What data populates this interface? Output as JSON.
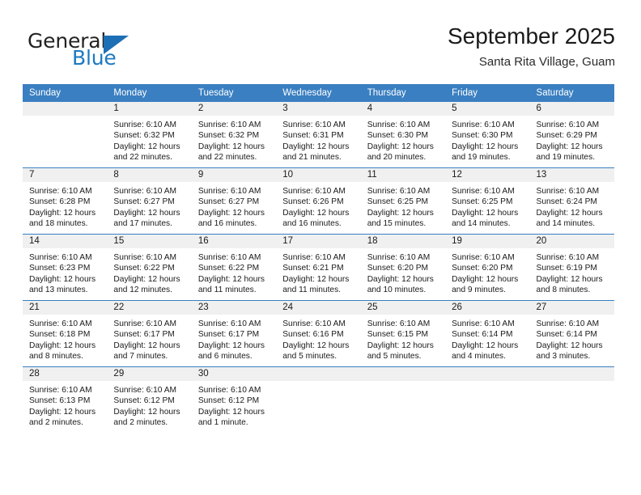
{
  "brand": {
    "name_part1": "General",
    "name_part2": "Blue",
    "triangle_color": "#1c6fb5",
    "blue_text_color": "#1c79c0"
  },
  "header": {
    "title": "September 2025",
    "subtitle": "Santa Rita Village, Guam"
  },
  "theme": {
    "header_row_background": "#3a7fc1",
    "header_row_text": "#ffffff",
    "daynumber_band_background": "#f0f0f0",
    "cell_background": "#ffffff",
    "row_divider": "#3a7fc1"
  },
  "weekday_headers": [
    "Sunday",
    "Monday",
    "Tuesday",
    "Wednesday",
    "Thursday",
    "Friday",
    "Saturday"
  ],
  "weeks": [
    [
      {
        "day": "",
        "blank": true,
        "sunrise": "",
        "sunset": "",
        "daylight_line1": "",
        "daylight_line2": ""
      },
      {
        "day": "1",
        "sunrise": "Sunrise: 6:10 AM",
        "sunset": "Sunset: 6:32 PM",
        "daylight_line1": "Daylight: 12 hours",
        "daylight_line2": "and 22 minutes."
      },
      {
        "day": "2",
        "sunrise": "Sunrise: 6:10 AM",
        "sunset": "Sunset: 6:32 PM",
        "daylight_line1": "Daylight: 12 hours",
        "daylight_line2": "and 22 minutes."
      },
      {
        "day": "3",
        "sunrise": "Sunrise: 6:10 AM",
        "sunset": "Sunset: 6:31 PM",
        "daylight_line1": "Daylight: 12 hours",
        "daylight_line2": "and 21 minutes."
      },
      {
        "day": "4",
        "sunrise": "Sunrise: 6:10 AM",
        "sunset": "Sunset: 6:30 PM",
        "daylight_line1": "Daylight: 12 hours",
        "daylight_line2": "and 20 minutes."
      },
      {
        "day": "5",
        "sunrise": "Sunrise: 6:10 AM",
        "sunset": "Sunset: 6:30 PM",
        "daylight_line1": "Daylight: 12 hours",
        "daylight_line2": "and 19 minutes."
      },
      {
        "day": "6",
        "sunrise": "Sunrise: 6:10 AM",
        "sunset": "Sunset: 6:29 PM",
        "daylight_line1": "Daylight: 12 hours",
        "daylight_line2": "and 19 minutes."
      }
    ],
    [
      {
        "day": "7",
        "sunrise": "Sunrise: 6:10 AM",
        "sunset": "Sunset: 6:28 PM",
        "daylight_line1": "Daylight: 12 hours",
        "daylight_line2": "and 18 minutes."
      },
      {
        "day": "8",
        "sunrise": "Sunrise: 6:10 AM",
        "sunset": "Sunset: 6:27 PM",
        "daylight_line1": "Daylight: 12 hours",
        "daylight_line2": "and 17 minutes."
      },
      {
        "day": "9",
        "sunrise": "Sunrise: 6:10 AM",
        "sunset": "Sunset: 6:27 PM",
        "daylight_line1": "Daylight: 12 hours",
        "daylight_line2": "and 16 minutes."
      },
      {
        "day": "10",
        "sunrise": "Sunrise: 6:10 AM",
        "sunset": "Sunset: 6:26 PM",
        "daylight_line1": "Daylight: 12 hours",
        "daylight_line2": "and 16 minutes."
      },
      {
        "day": "11",
        "sunrise": "Sunrise: 6:10 AM",
        "sunset": "Sunset: 6:25 PM",
        "daylight_line1": "Daylight: 12 hours",
        "daylight_line2": "and 15 minutes."
      },
      {
        "day": "12",
        "sunrise": "Sunrise: 6:10 AM",
        "sunset": "Sunset: 6:25 PM",
        "daylight_line1": "Daylight: 12 hours",
        "daylight_line2": "and 14 minutes."
      },
      {
        "day": "13",
        "sunrise": "Sunrise: 6:10 AM",
        "sunset": "Sunset: 6:24 PM",
        "daylight_line1": "Daylight: 12 hours",
        "daylight_line2": "and 14 minutes."
      }
    ],
    [
      {
        "day": "14",
        "sunrise": "Sunrise: 6:10 AM",
        "sunset": "Sunset: 6:23 PM",
        "daylight_line1": "Daylight: 12 hours",
        "daylight_line2": "and 13 minutes."
      },
      {
        "day": "15",
        "sunrise": "Sunrise: 6:10 AM",
        "sunset": "Sunset: 6:22 PM",
        "daylight_line1": "Daylight: 12 hours",
        "daylight_line2": "and 12 minutes."
      },
      {
        "day": "16",
        "sunrise": "Sunrise: 6:10 AM",
        "sunset": "Sunset: 6:22 PM",
        "daylight_line1": "Daylight: 12 hours",
        "daylight_line2": "and 11 minutes."
      },
      {
        "day": "17",
        "sunrise": "Sunrise: 6:10 AM",
        "sunset": "Sunset: 6:21 PM",
        "daylight_line1": "Daylight: 12 hours",
        "daylight_line2": "and 11 minutes."
      },
      {
        "day": "18",
        "sunrise": "Sunrise: 6:10 AM",
        "sunset": "Sunset: 6:20 PM",
        "daylight_line1": "Daylight: 12 hours",
        "daylight_line2": "and 10 minutes."
      },
      {
        "day": "19",
        "sunrise": "Sunrise: 6:10 AM",
        "sunset": "Sunset: 6:20 PM",
        "daylight_line1": "Daylight: 12 hours",
        "daylight_line2": "and 9 minutes."
      },
      {
        "day": "20",
        "sunrise": "Sunrise: 6:10 AM",
        "sunset": "Sunset: 6:19 PM",
        "daylight_line1": "Daylight: 12 hours",
        "daylight_line2": "and 8 minutes."
      }
    ],
    [
      {
        "day": "21",
        "sunrise": "Sunrise: 6:10 AM",
        "sunset": "Sunset: 6:18 PM",
        "daylight_line1": "Daylight: 12 hours",
        "daylight_line2": "and 8 minutes."
      },
      {
        "day": "22",
        "sunrise": "Sunrise: 6:10 AM",
        "sunset": "Sunset: 6:17 PM",
        "daylight_line1": "Daylight: 12 hours",
        "daylight_line2": "and 7 minutes."
      },
      {
        "day": "23",
        "sunrise": "Sunrise: 6:10 AM",
        "sunset": "Sunset: 6:17 PM",
        "daylight_line1": "Daylight: 12 hours",
        "daylight_line2": "and 6 minutes."
      },
      {
        "day": "24",
        "sunrise": "Sunrise: 6:10 AM",
        "sunset": "Sunset: 6:16 PM",
        "daylight_line1": "Daylight: 12 hours",
        "daylight_line2": "and 5 minutes."
      },
      {
        "day": "25",
        "sunrise": "Sunrise: 6:10 AM",
        "sunset": "Sunset: 6:15 PM",
        "daylight_line1": "Daylight: 12 hours",
        "daylight_line2": "and 5 minutes."
      },
      {
        "day": "26",
        "sunrise": "Sunrise: 6:10 AM",
        "sunset": "Sunset: 6:14 PM",
        "daylight_line1": "Daylight: 12 hours",
        "daylight_line2": "and 4 minutes."
      },
      {
        "day": "27",
        "sunrise": "Sunrise: 6:10 AM",
        "sunset": "Sunset: 6:14 PM",
        "daylight_line1": "Daylight: 12 hours",
        "daylight_line2": "and 3 minutes."
      }
    ],
    [
      {
        "day": "28",
        "sunrise": "Sunrise: 6:10 AM",
        "sunset": "Sunset: 6:13 PM",
        "daylight_line1": "Daylight: 12 hours",
        "daylight_line2": "and 2 minutes."
      },
      {
        "day": "29",
        "sunrise": "Sunrise: 6:10 AM",
        "sunset": "Sunset: 6:12 PM",
        "daylight_line1": "Daylight: 12 hours",
        "daylight_line2": "and 2 minutes."
      },
      {
        "day": "30",
        "sunrise": "Sunrise: 6:10 AM",
        "sunset": "Sunset: 6:12 PM",
        "daylight_line1": "Daylight: 12 hours",
        "daylight_line2": "and 1 minute."
      },
      {
        "day": "",
        "blank": true,
        "sunrise": "",
        "sunset": "",
        "daylight_line1": "",
        "daylight_line2": ""
      },
      {
        "day": "",
        "blank": true,
        "sunrise": "",
        "sunset": "",
        "daylight_line1": "",
        "daylight_line2": ""
      },
      {
        "day": "",
        "blank": true,
        "sunrise": "",
        "sunset": "",
        "daylight_line1": "",
        "daylight_line2": ""
      },
      {
        "day": "",
        "blank": true,
        "sunrise": "",
        "sunset": "",
        "daylight_line1": "",
        "daylight_line2": ""
      }
    ]
  ]
}
